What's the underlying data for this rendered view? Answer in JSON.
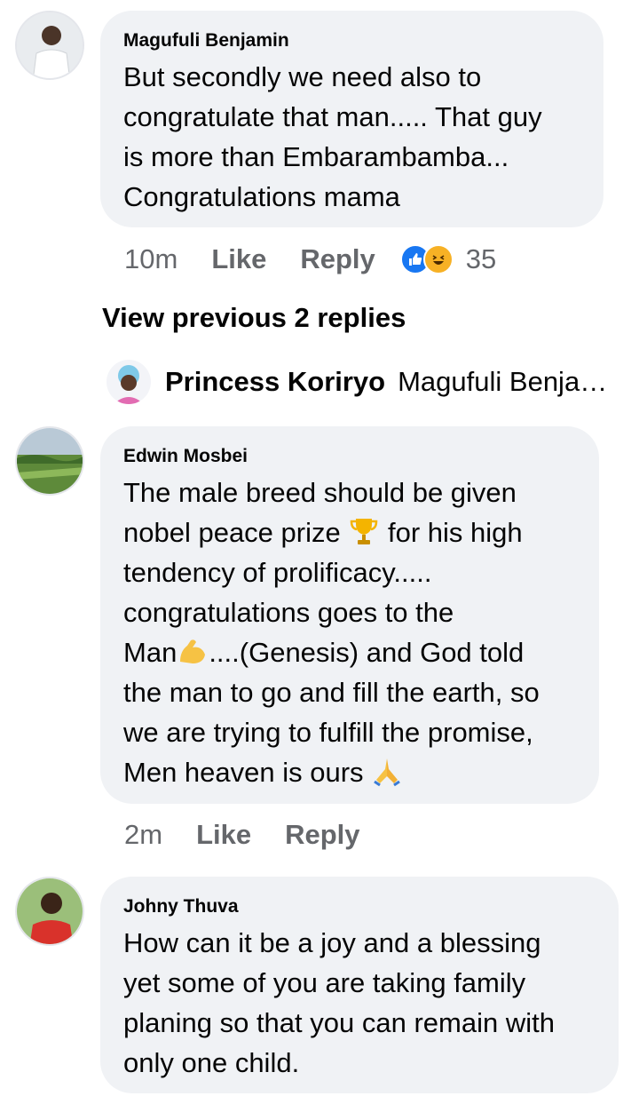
{
  "comments": [
    {
      "author": "Magufuli Benjamin",
      "lines": [
        "But secondly we need also to",
        "congratulate that man..... That guy",
        "is more than Embarambamba...",
        "Congratulations mama"
      ],
      "time": "10m",
      "like_label": "Like",
      "reply_label": "Reply",
      "reaction_count": "35",
      "reactions": [
        "like-icon",
        "haha-icon"
      ]
    },
    {
      "author": "Edwin Mosbei",
      "line1": "The male breed should be given",
      "line2a": "nobel peace prize",
      "line2b": "for his high",
      "line3": "tendency of prolificacy.....",
      "line4": "congratulations goes to the",
      "line5a": "Man",
      "line5b": "....(Genesis) and God told",
      "line6": "the man to go and fill the earth, so",
      "line7": "we are trying to fulfill the promise,",
      "line8": "Men heaven is ours",
      "time": "2m",
      "like_label": "Like",
      "reply_label": "Reply",
      "emojis": [
        "trophy-icon",
        "flexed-bicep-icon",
        "folded-hands-icon"
      ]
    },
    {
      "author": "Johny Thuva",
      "lines": [
        "How can it be a joy and a blessing",
        "yet some of you are taking family",
        "planing so that you can remain with",
        "only one child."
      ]
    }
  ],
  "view_previous": "View previous 2 replies",
  "reply_preview": {
    "author": "Princess Koriryo",
    "text": "Magufuli Benjamin"
  },
  "colors": {
    "bubble": "#f0f2f5",
    "meta": "#65676b",
    "like_blue": "#1877f2",
    "haha_yellow": "#f7b125"
  }
}
